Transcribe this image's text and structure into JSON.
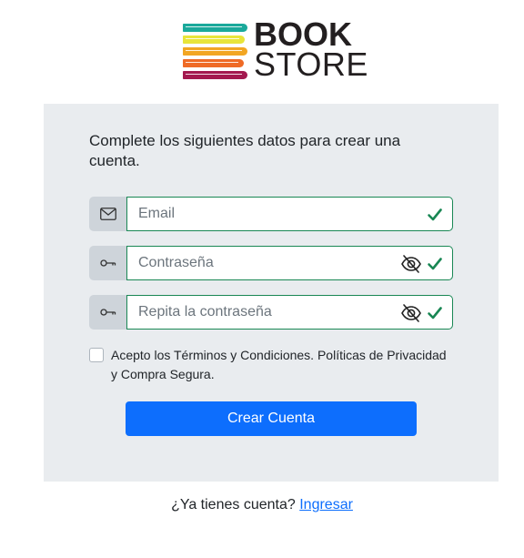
{
  "logo": {
    "line1": "BOOK",
    "line2": "STORE",
    "book_colors": [
      "#1aa99b",
      "#e8e53a",
      "#f2a623",
      "#ef6a25",
      "#a3194f"
    ]
  },
  "form": {
    "title": "Complete los siguientes datos para crear una cuenta.",
    "email": {
      "placeholder": "Email",
      "value": "",
      "icon": "envelope-icon",
      "valid": true
    },
    "password": {
      "placeholder": "Contraseña",
      "value": "",
      "icon": "key-icon",
      "toggle_icon": "eye-slash-icon",
      "valid": true
    },
    "repeat_password": {
      "placeholder": "Repita la contraseña",
      "value": "",
      "icon": "key-icon",
      "toggle_icon": "eye-slash-icon",
      "valid": true
    },
    "terms": {
      "checked": false,
      "label": "Acepto los Términos y Condiciones. Políticas de Privacidad y Compra Segura."
    },
    "submit_label": "Crear Cuenta"
  },
  "footer": {
    "prompt": "¿Ya tienes cuenta?",
    "link_label": "Ingresar"
  },
  "colors": {
    "card_bg": "#e9ecef",
    "primary": "#0d6efd",
    "valid": "#198754",
    "addon_bg": "#ced4da"
  }
}
